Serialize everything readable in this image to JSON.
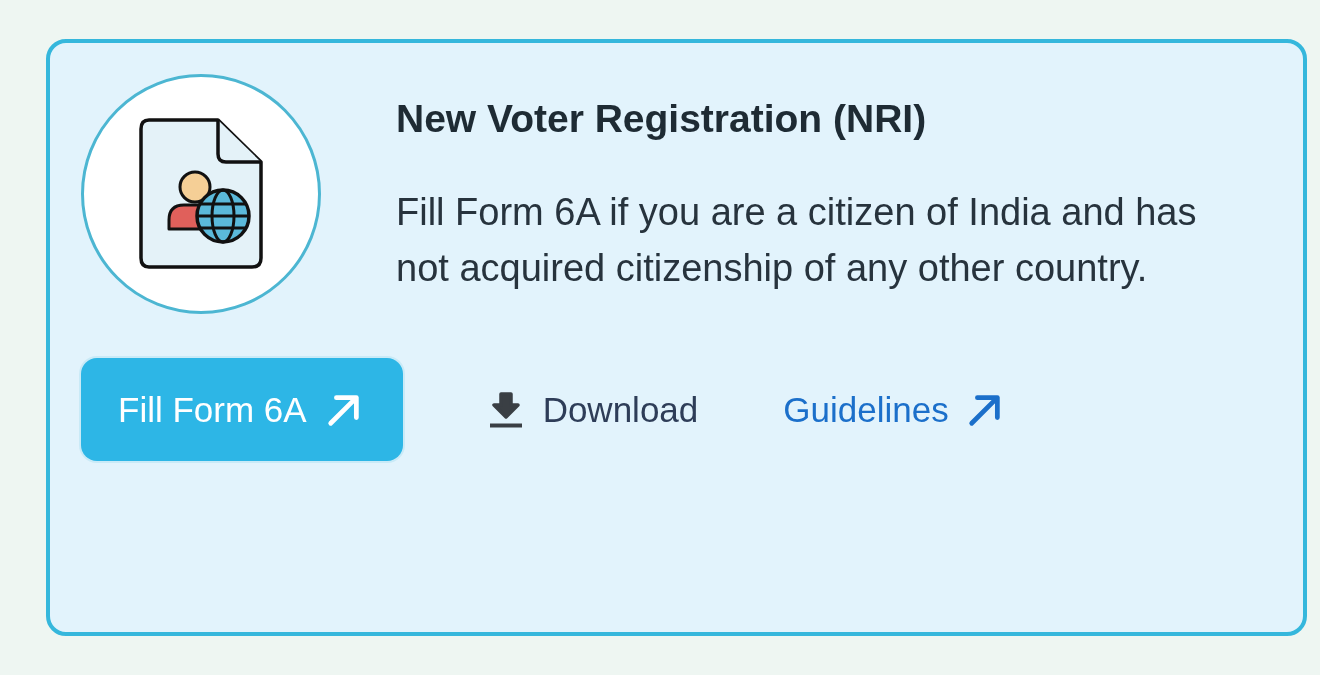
{
  "card": {
    "title": "New Voter Registration (NRI)",
    "description": "Fill Form 6A if you are a citizen of India and has not acquired citizenship of any other country.",
    "actions": [
      {
        "kind": "primary",
        "label": "Fill Form 6A"
      },
      {
        "kind": "download",
        "label": "Download"
      },
      {
        "kind": "link",
        "label": "Guidelines"
      }
    ]
  }
}
